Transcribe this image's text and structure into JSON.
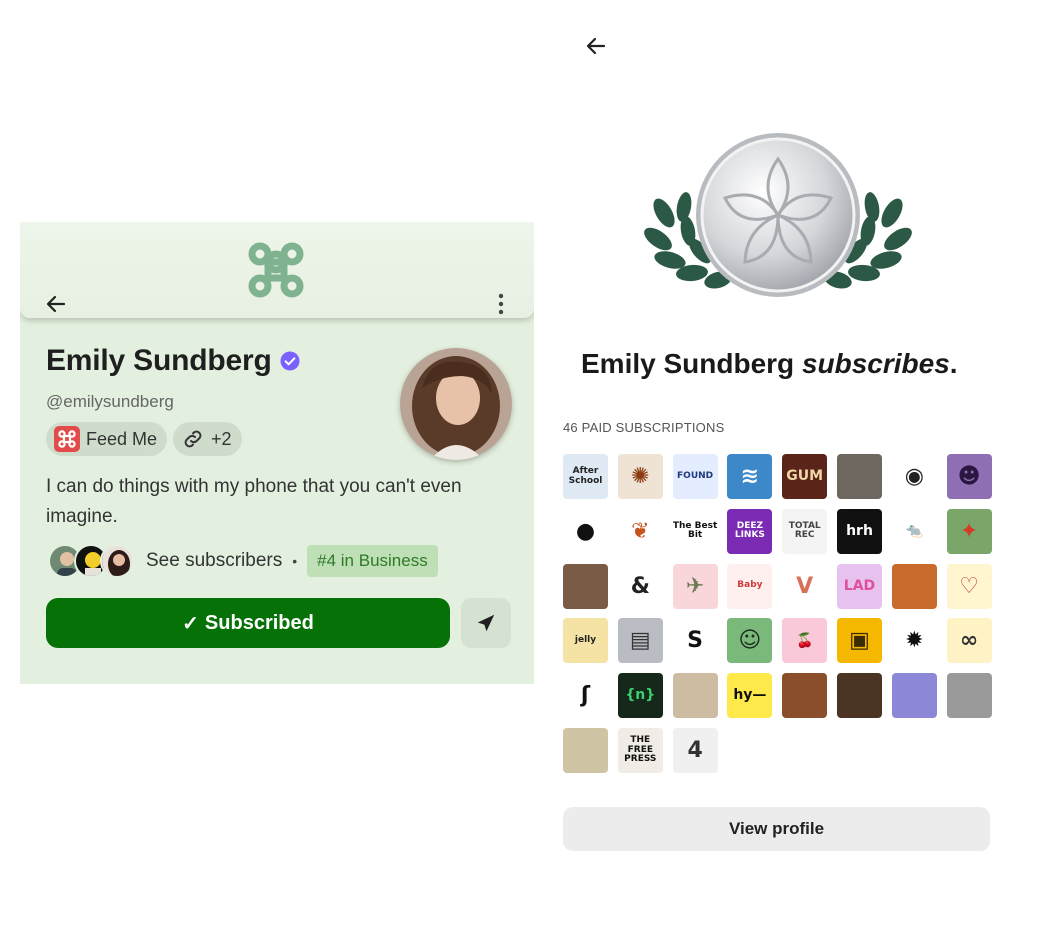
{
  "left": {
    "creator_name": "Emily Sundberg",
    "handle": "@emilysundberg",
    "chips": [
      {
        "label": "Feed Me",
        "icon": "command-icon"
      },
      {
        "label": "+2",
        "icon": "link-icon"
      }
    ],
    "bio": "I can do things with my phone that you can't even imagine.",
    "see_subscribers": "See subscribers",
    "separator": "•",
    "rank_badge": "#4 in Business",
    "subscribed_label": "Subscribed",
    "check": "✓"
  },
  "right": {
    "title_name": "Emily Sundberg",
    "title_verb": "subscribes",
    "title_period": ".",
    "paid_count": "46 PAID SUBSCRIPTIONS",
    "view_profile": "View profile",
    "tiles": [
      {
        "label": "After School",
        "bg": "#dfe9f3",
        "fg": "#222"
      },
      {
        "label": "✺",
        "bg": "#efe3d6",
        "fg": "#8a3b10"
      },
      {
        "label": "FOUND",
        "bg": "#e4ecff",
        "fg": "#1d3a7a"
      },
      {
        "label": "≋",
        "bg": "#3d88c9",
        "fg": "#ffffff"
      },
      {
        "label": "GUM",
        "bg": "#5a2418",
        "fg": "#f2d6a8"
      },
      {
        "label": "",
        "bg": "#6e6760",
        "fg": "#fff"
      },
      {
        "label": "◉",
        "bg": "#ffffff",
        "fg": "#222"
      },
      {
        "label": "☻",
        "bg": "#8e6fb3",
        "fg": "#2a1640"
      },
      {
        "label": "●",
        "bg": "#ffffff",
        "fg": "#111"
      },
      {
        "label": "❦",
        "bg": "#ffffff",
        "fg": "#c55320"
      },
      {
        "label": "The Best Bit",
        "bg": "#ffffff",
        "fg": "#111"
      },
      {
        "label": "DEEZ LINKS",
        "bg": "#7b2bb3",
        "fg": "#ffffff"
      },
      {
        "label": "TOTAL REC",
        "bg": "#f4f4f4",
        "fg": "#444"
      },
      {
        "label": "hrh",
        "bg": "#111111",
        "fg": "#ffffff"
      },
      {
        "label": "🐀",
        "bg": "#ffffff",
        "fg": "#333"
      },
      {
        "label": "✦",
        "bg": "#7aa66a",
        "fg": "#d23d2a"
      },
      {
        "label": "",
        "bg": "#7a5c46",
        "fg": "#fff"
      },
      {
        "label": "&",
        "bg": "#ffffff",
        "fg": "#222"
      },
      {
        "label": "✈",
        "bg": "#f8d6d9",
        "fg": "#6b7a55"
      },
      {
        "label": "Baby",
        "bg": "#fff0f0",
        "fg": "#d03a3a"
      },
      {
        "label": "V",
        "bg": "#ffffff",
        "fg": "#d9705a"
      },
      {
        "label": "LAD",
        "bg": "#e8c2ee",
        "fg": "#e04f9c"
      },
      {
        "label": "",
        "bg": "#c96b2c",
        "fg": "#fff"
      },
      {
        "label": "♡",
        "bg": "#fff6cf",
        "fg": "#c04040"
      },
      {
        "label": "jelly",
        "bg": "#f4e3a4",
        "fg": "#222"
      },
      {
        "label": "▤",
        "bg": "#b9bcc2",
        "fg": "#333"
      },
      {
        "label": "S",
        "bg": "#ffffff",
        "fg": "#111"
      },
      {
        "label": "☺",
        "bg": "#7bb97b",
        "fg": "#1d2d1d"
      },
      {
        "label": "🍒",
        "bg": "#f9c9d9",
        "fg": "#c20f2f"
      },
      {
        "label": "▣",
        "bg": "#f6b700",
        "fg": "#3a2b00"
      },
      {
        "label": "✹",
        "bg": "#ffffff",
        "fg": "#111"
      },
      {
        "label": "∞",
        "bg": "#fff3c6",
        "fg": "#333"
      },
      {
        "label": "ʃ",
        "bg": "#ffffff",
        "fg": "#111"
      },
      {
        "label": "{n}",
        "bg": "#15281a",
        "fg": "#3ad16f"
      },
      {
        "label": "",
        "bg": "#cdbba2",
        "fg": "#fff"
      },
      {
        "label": "hy—",
        "bg": "#ffe94a",
        "fg": "#111"
      },
      {
        "label": "",
        "bg": "#8a4f2a",
        "fg": "#fff"
      },
      {
        "label": "",
        "bg": "#4b3424",
        "fg": "#fff"
      },
      {
        "label": "",
        "bg": "#8c87d6",
        "fg": "#fff"
      },
      {
        "label": "",
        "bg": "#9a9a9a",
        "fg": "#fff"
      },
      {
        "label": "",
        "bg": "#cfc5a5",
        "fg": "#fff"
      },
      {
        "label": "THE FREE PRESS",
        "bg": "#f1ede6",
        "fg": "#111"
      },
      {
        "label": "4",
        "bg": "#f0f0f0",
        "fg": "#333"
      }
    ]
  },
  "colors": {
    "accent_green": "#067106",
    "rank_green": "#2f7a26",
    "verified_purple": "#7b61ff",
    "laurel_green": "#2c5945"
  }
}
